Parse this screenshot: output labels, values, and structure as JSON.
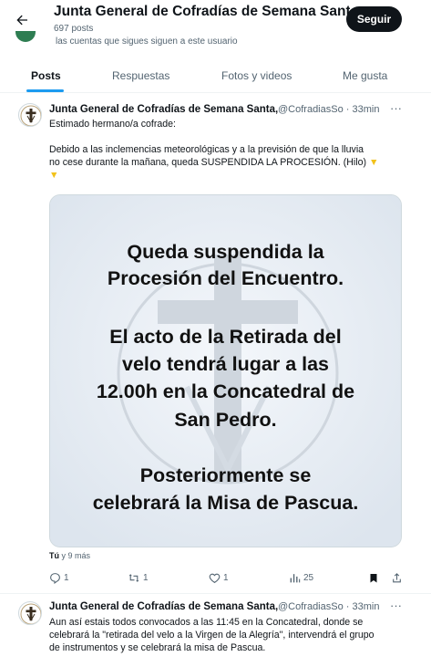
{
  "profile": {
    "name": "Junta General de Cofradías de Semana Santa",
    "posts_count": "697 posts",
    "follow_note": "las cuentas que sigues siguen a este usuario",
    "follow_label": "Seguir",
    "accent_color": "#1d9bf0"
  },
  "tabs": [
    {
      "label": "Posts",
      "active": true
    },
    {
      "label": "Respuestas",
      "active": false
    },
    {
      "label": "Fotos y videos",
      "active": false
    },
    {
      "label": "Me gusta",
      "active": false
    }
  ],
  "tweets": [
    {
      "author": "Junta General de Cofradías de Semana Santa,",
      "handle_time": "@CofradiasSo · 33min",
      "more": "···",
      "lines": [
        "Estimado hermano/a cofrade:",
        "",
        "Debido a las inclemencias meteorológicas y a la previsión de que la lluvia",
        "no cese durante la mañana, queda SUSPENDIDA LA PROCESIÓN. (Hilo)",
        ""
      ],
      "emoji_icon": "pointing-down-hand-icon",
      "media": {
        "lines": [
          "Queda suspendida la",
          "Procesión del Encuentro.",
          "El acto de la Retirada del",
          "velo tendrá lugar a las",
          "12.00h en la Concatedral de",
          "San Pedro.",
          "Posteriormente se",
          "celebrará la Misa de Pascua."
        ]
      },
      "liked_by_prefix": "Tú",
      "liked_by_suffix": " y 9 más",
      "actions": {
        "replies": "1",
        "reposts": "1",
        "likes": "1",
        "views": "25"
      }
    },
    {
      "author": "Junta General de Cofradías de Semana Santa,",
      "handle_time": "@CofradiasSo · 33min",
      "more": "···",
      "lines": [
        "Aun así estais todos convocados a las 11:45 en la Concatedral, donde se",
        "celebrará la \"retirada del velo a la Virgen de la Alegría\", intervendrá el grupo",
        "de instrumentos y se celebrará la misa de Pascua."
      ]
    }
  ]
}
